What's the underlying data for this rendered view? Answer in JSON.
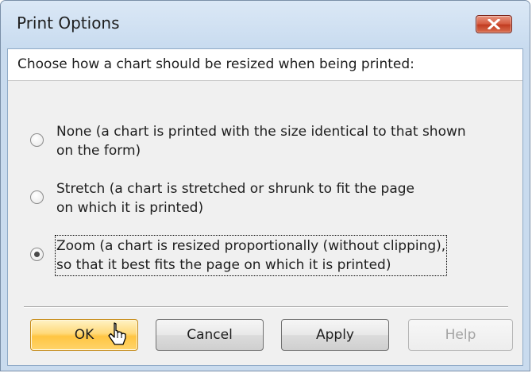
{
  "window": {
    "title": "Print Options",
    "close_icon": "close-icon"
  },
  "prompt": "Choose how a chart should be resized when being printed:",
  "options": [
    {
      "line1": "None (a chart is printed with the size identical to that shown",
      "line2": "on the form)",
      "selected": false
    },
    {
      "line1": "Stretch (a chart is stretched or shrunk to fit the page",
      "line2": "on which it is printed)",
      "selected": false
    },
    {
      "line1": "Zoom (a chart is resized proportionally (without clipping),",
      "line2": "so that it best fits the page on which it is printed)",
      "selected": true
    }
  ],
  "buttons": {
    "ok": "OK",
    "cancel": "Cancel",
    "apply": "Apply",
    "help": "Help",
    "help_enabled": false
  },
  "colors": {
    "primary_button": "#ffd46b",
    "close_button": "#d55a3f",
    "title_bar": "#c9dbee"
  }
}
